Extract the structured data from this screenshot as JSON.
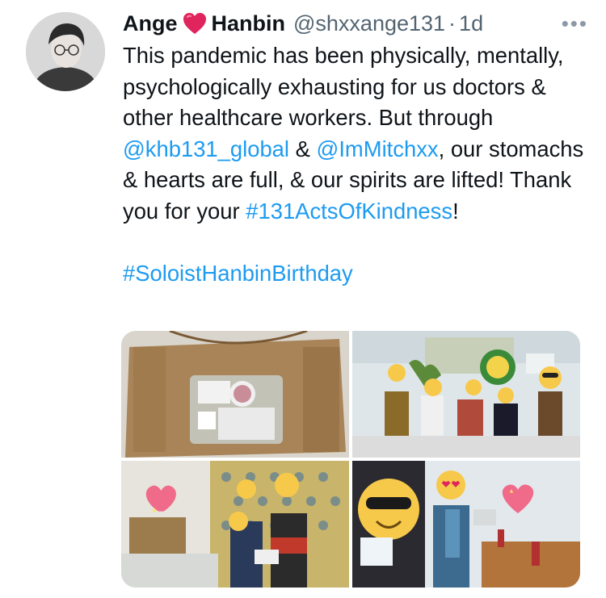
{
  "tweet": {
    "author_first": "Ange",
    "author_last": "Hanbin",
    "handle": "@shxxange131",
    "separator": "·",
    "time": "1d",
    "more": "•••",
    "body": {
      "p1": "This pandemic has been physically, mentally, psychologically exhausting for us doctors & other healthcare workers. But through ",
      "mention1": "@khb131_global",
      "p2": " & ",
      "mention2": "@ImMitchxx",
      "p3": ", our stomachs & hearts are full, & our spirits are lifted! Thank you for your ",
      "hashtag1": "#131ActsOfKindness",
      "p4": "!",
      "hashtag2": "#SoloistHanbinBirthday"
    }
  },
  "icons": {
    "heart": "red-heart-emoji",
    "avatar": "profile-photo",
    "more": "more-options-icon"
  },
  "colors": {
    "link": "#1d9bf0",
    "text": "#0f1419",
    "muted": "#536471",
    "heart": "#e0245e"
  }
}
